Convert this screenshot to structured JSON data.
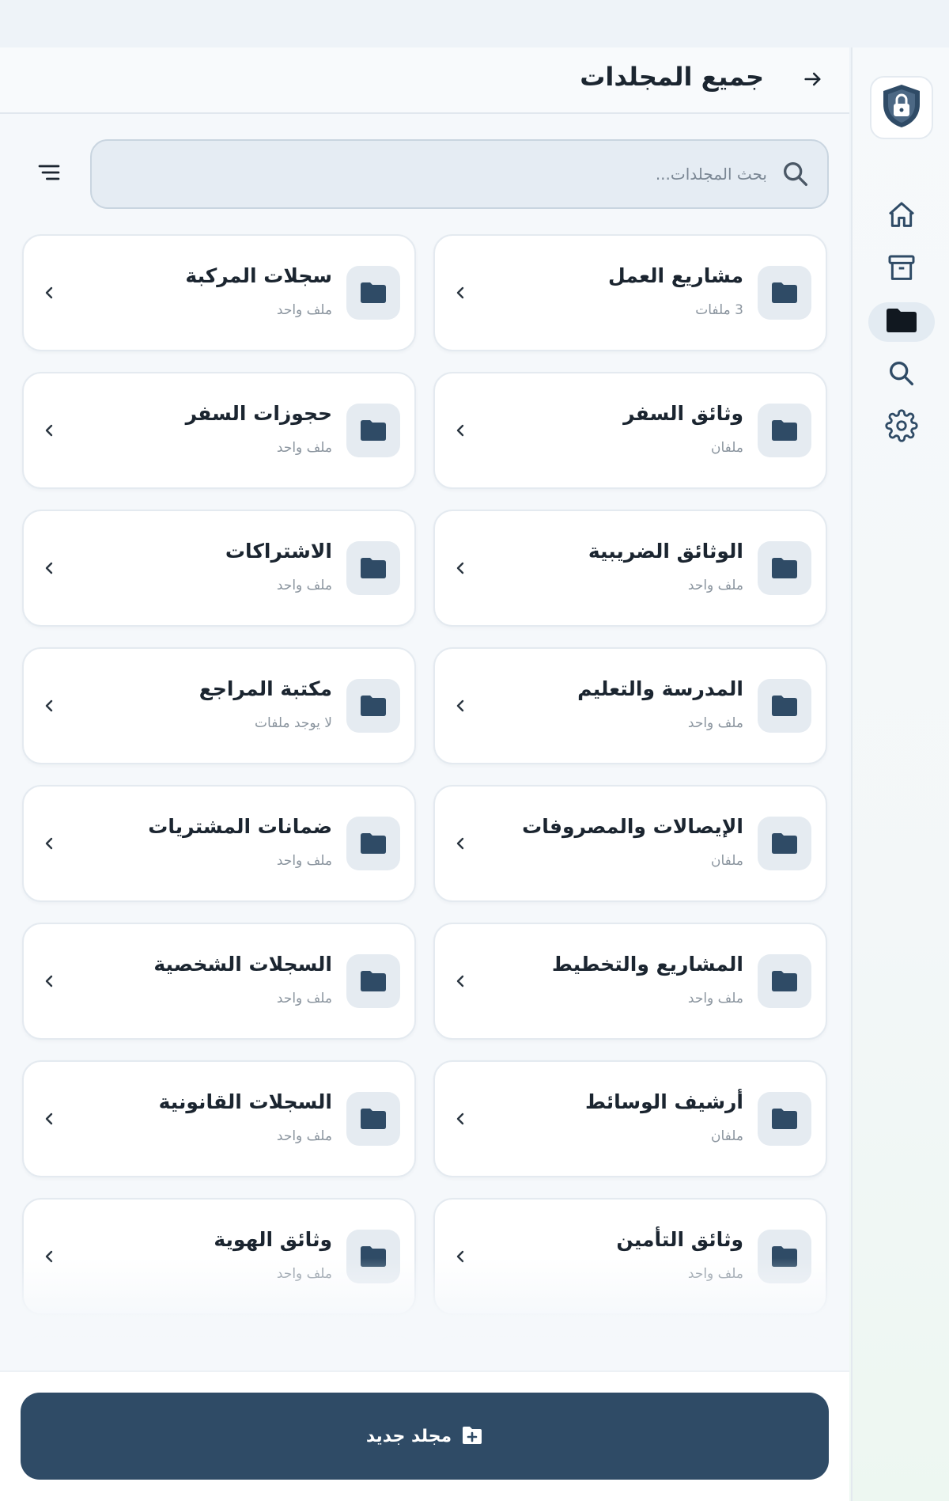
{
  "header": {
    "title": "جميع المجلدات",
    "back_icon": "arrow-right-icon"
  },
  "search": {
    "placeholder": "بحث المجلدات...",
    "value": "",
    "icon": "search-icon"
  },
  "filter": {
    "icon": "filter-lines-icon"
  },
  "sidebar": {
    "logo_icon": "shield-lock-icon",
    "items": [
      {
        "icon": "home-icon",
        "active": false
      },
      {
        "icon": "archive-icon",
        "active": false
      },
      {
        "icon": "folder-icon",
        "active": true
      },
      {
        "icon": "search-icon",
        "active": false
      },
      {
        "icon": "gear-icon",
        "active": false
      }
    ]
  },
  "folders": [
    {
      "name": "مشاريع العمل",
      "count": "3 ملفات"
    },
    {
      "name": "سجلات المركبة",
      "count": "ملف واحد"
    },
    {
      "name": "وثائق السفر",
      "count": "ملفان"
    },
    {
      "name": "حجوزات السفر",
      "count": "ملف واحد"
    },
    {
      "name": "الوثائق الضريبية",
      "count": "ملف واحد"
    },
    {
      "name": "الاشتراكات",
      "count": "ملف واحد"
    },
    {
      "name": "المدرسة والتعليم",
      "count": "ملف واحد"
    },
    {
      "name": "مكتبة المراجع",
      "count": "لا يوجد ملفات"
    },
    {
      "name": "الإيصالات والمصروفات",
      "count": "ملفان"
    },
    {
      "name": "ضمانات المشتريات",
      "count": "ملف واحد"
    },
    {
      "name": "المشاريع والتخطيط",
      "count": "ملف واحد"
    },
    {
      "name": "السجلات الشخصية",
      "count": "ملف واحد"
    },
    {
      "name": "أرشيف الوسائط",
      "count": "ملفان"
    },
    {
      "name": "السجلات القانونية",
      "count": "ملف واحد"
    },
    {
      "name": "وثائق التأمين",
      "count": "ملف واحد"
    },
    {
      "name": "وثائق الهوية",
      "count": "ملف واحد"
    }
  ],
  "footer": {
    "new_folder_label": "مجلد جديد",
    "new_folder_icon": "folder-plus-icon"
  },
  "colors": {
    "primary": "#2f4b66",
    "folder_icon": "#2f4b66",
    "card_bg": "#ffffff",
    "active_nav_bg": "#e3ebf2"
  }
}
